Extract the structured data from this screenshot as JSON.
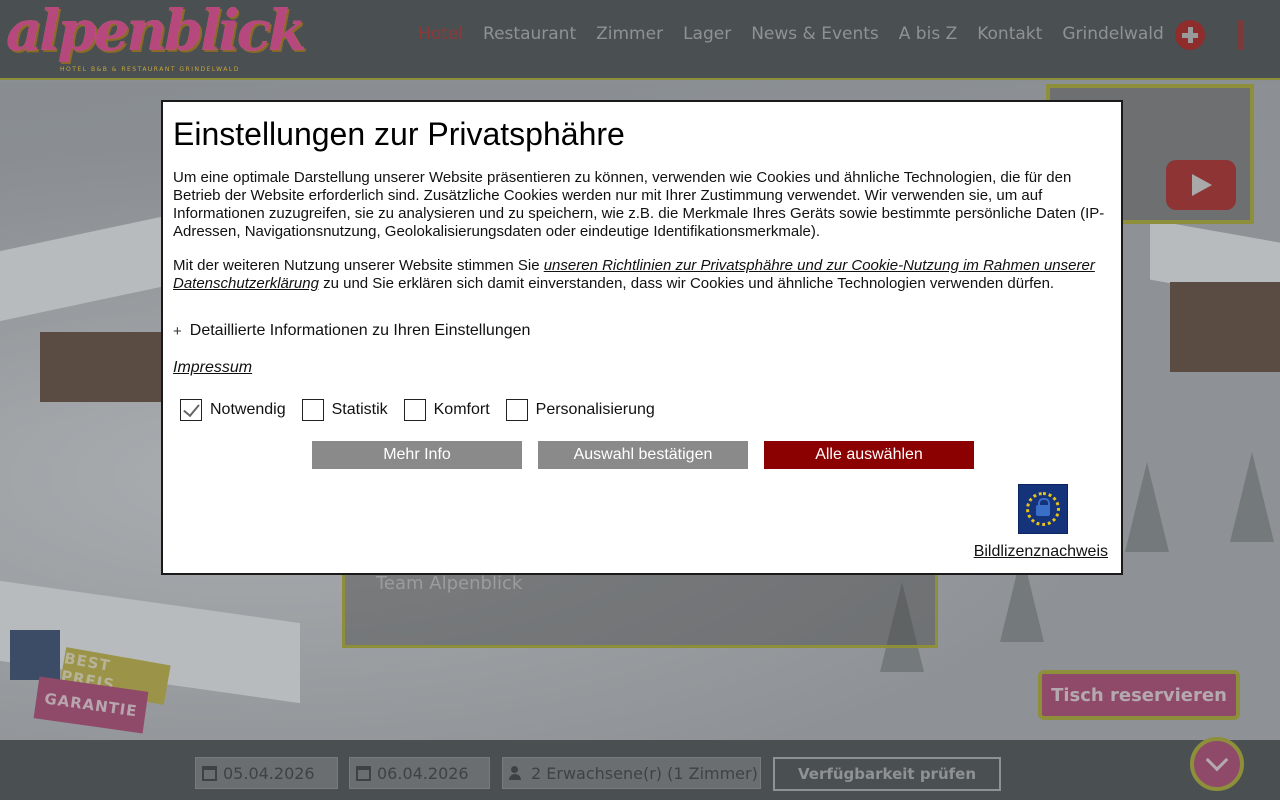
{
  "header": {
    "logo_text": "alpenblick",
    "logo_subtitle": "HOTEL B&B & RESTAURANT GRINDELWALD",
    "nav": [
      {
        "label": "Hotel",
        "active": true
      },
      {
        "label": "Restaurant"
      },
      {
        "label": "Zimmer"
      },
      {
        "label": "Lager"
      },
      {
        "label": "News & Events"
      },
      {
        "label": "A bis Z"
      },
      {
        "label": "Kontakt"
      },
      {
        "label": "Grindelwald"
      }
    ],
    "languages": [
      "swiss-flag-icon",
      "german-flag-icon"
    ]
  },
  "background": {
    "greeting_signature": "Team Alpenblick",
    "badge_best": "BEST PREIS",
    "badge_guarantee": "GARANTIE",
    "reserve_button": "Tisch reservieren"
  },
  "booking": {
    "arrival": "05.04.2026",
    "departure": "06.04.2026",
    "guests": "2 Erwachsene(r) (1 Zimmer)",
    "check_button": "Verfügbarkeit prüfen"
  },
  "privacy_modal": {
    "title": "Einstellungen zur Privatsphähre",
    "paragraph1": "Um eine optimale Darstellung unserer Website präsentieren zu können, verwenden wie Cookies und ähnliche Technologien, die für den Betrieb der Website erforderlich sind. Zusätzliche Cookies werden nur mit Ihrer Zustimmung verwendet. Wir verwenden sie, um auf Informationen zuzugreifen, sie zu analysieren und zu speichern, wie z.B. die Merkmale Ihres Geräts sowie bestimmte persönliche Daten (IP-Adressen, Navigationsnutzung, Geolokalisierungsdaten oder eindeutige Identifikationsmerkmale).",
    "paragraph2_start": "Mit der weiteren Nutzung unserer Website stimmen Sie ",
    "paragraph2_link": "unseren Richtlinien zur Privatsphähre und zur Cookie-Nutzung im Rahmen unserer Datenschutzerklärung",
    "paragraph2_end": " zu und Sie erklären sich damit einverstanden, dass wir Cookies und ähnliche Technologien verwenden dürfen.",
    "details_toggle": "Detaillierte Informationen zu Ihren Einstellungen",
    "impressum": "Impressum",
    "checkboxes": [
      {
        "label": "Notwendig",
        "checked": true
      },
      {
        "label": "Statistik",
        "checked": false
      },
      {
        "label": "Komfort",
        "checked": false
      },
      {
        "label": "Personalisierung",
        "checked": false
      }
    ],
    "buttons": {
      "more_info": "Mehr Info",
      "confirm_selection": "Auswahl bestätigen",
      "select_all": "Alle auswählen"
    },
    "image_license": "Bildlizenznachweis"
  },
  "colors": {
    "accent_red": "#8b0000",
    "button_grey": "#8a8a8a",
    "brand_pink": "#8f4a69",
    "brand_gold": "#8d8f3a"
  }
}
